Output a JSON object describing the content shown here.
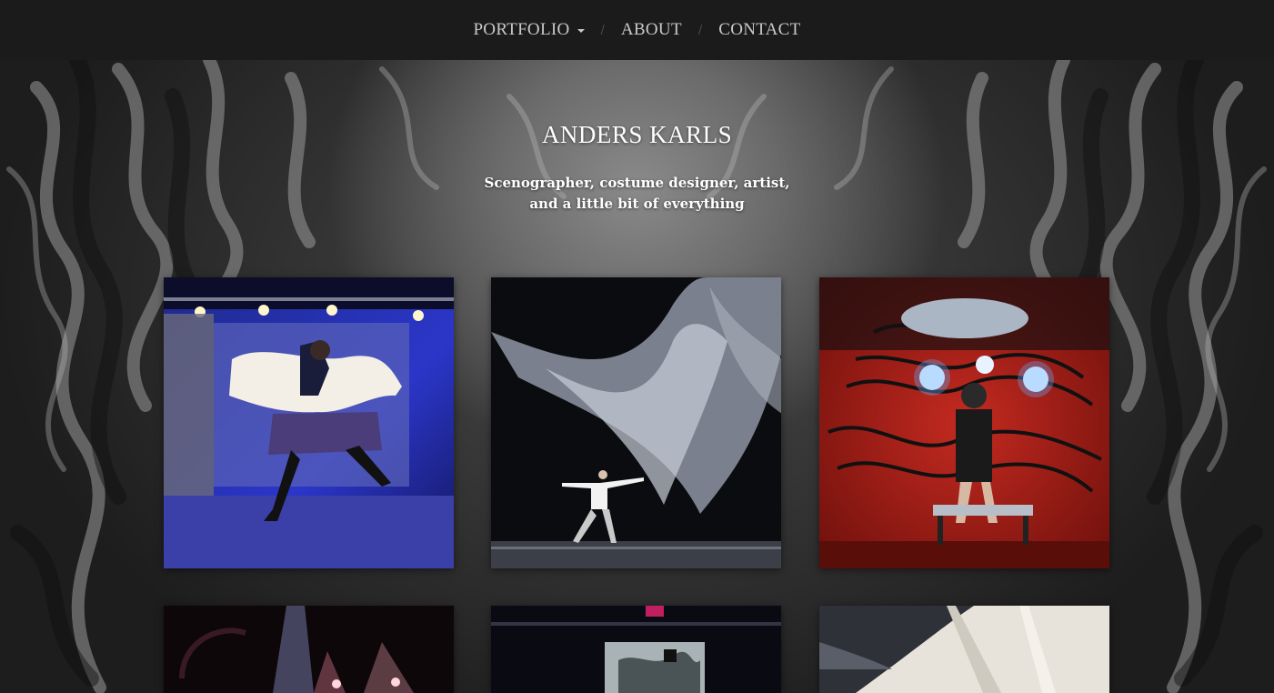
{
  "nav": {
    "items": [
      {
        "label": "PORTFOLIO",
        "has_dropdown": true
      },
      {
        "label": "ABOUT",
        "has_dropdown": false
      },
      {
        "label": "CONTACT",
        "has_dropdown": false
      }
    ],
    "separator": "/"
  },
  "hero": {
    "title": "ANDERS KARLS",
    "subtitle_line1": "Scenographer, costume designer, artist,",
    "subtitle_line2": "and a little bit of everything"
  },
  "gallery": {
    "items": [
      {
        "subject": "performer-with-map-cutout"
      },
      {
        "subject": "dancer-under-white-fabric"
      },
      {
        "subject": "figure-in-wired-machine-chair"
      },
      {
        "subject": "stage-lights-dark"
      },
      {
        "subject": "stage-with-hanging-screen"
      },
      {
        "subject": "white-tent-fabric"
      }
    ]
  },
  "colors": {
    "nav_bg": "#1b1b1b",
    "nav_text": "#c9c9c9",
    "title_text": "#ffffff"
  }
}
